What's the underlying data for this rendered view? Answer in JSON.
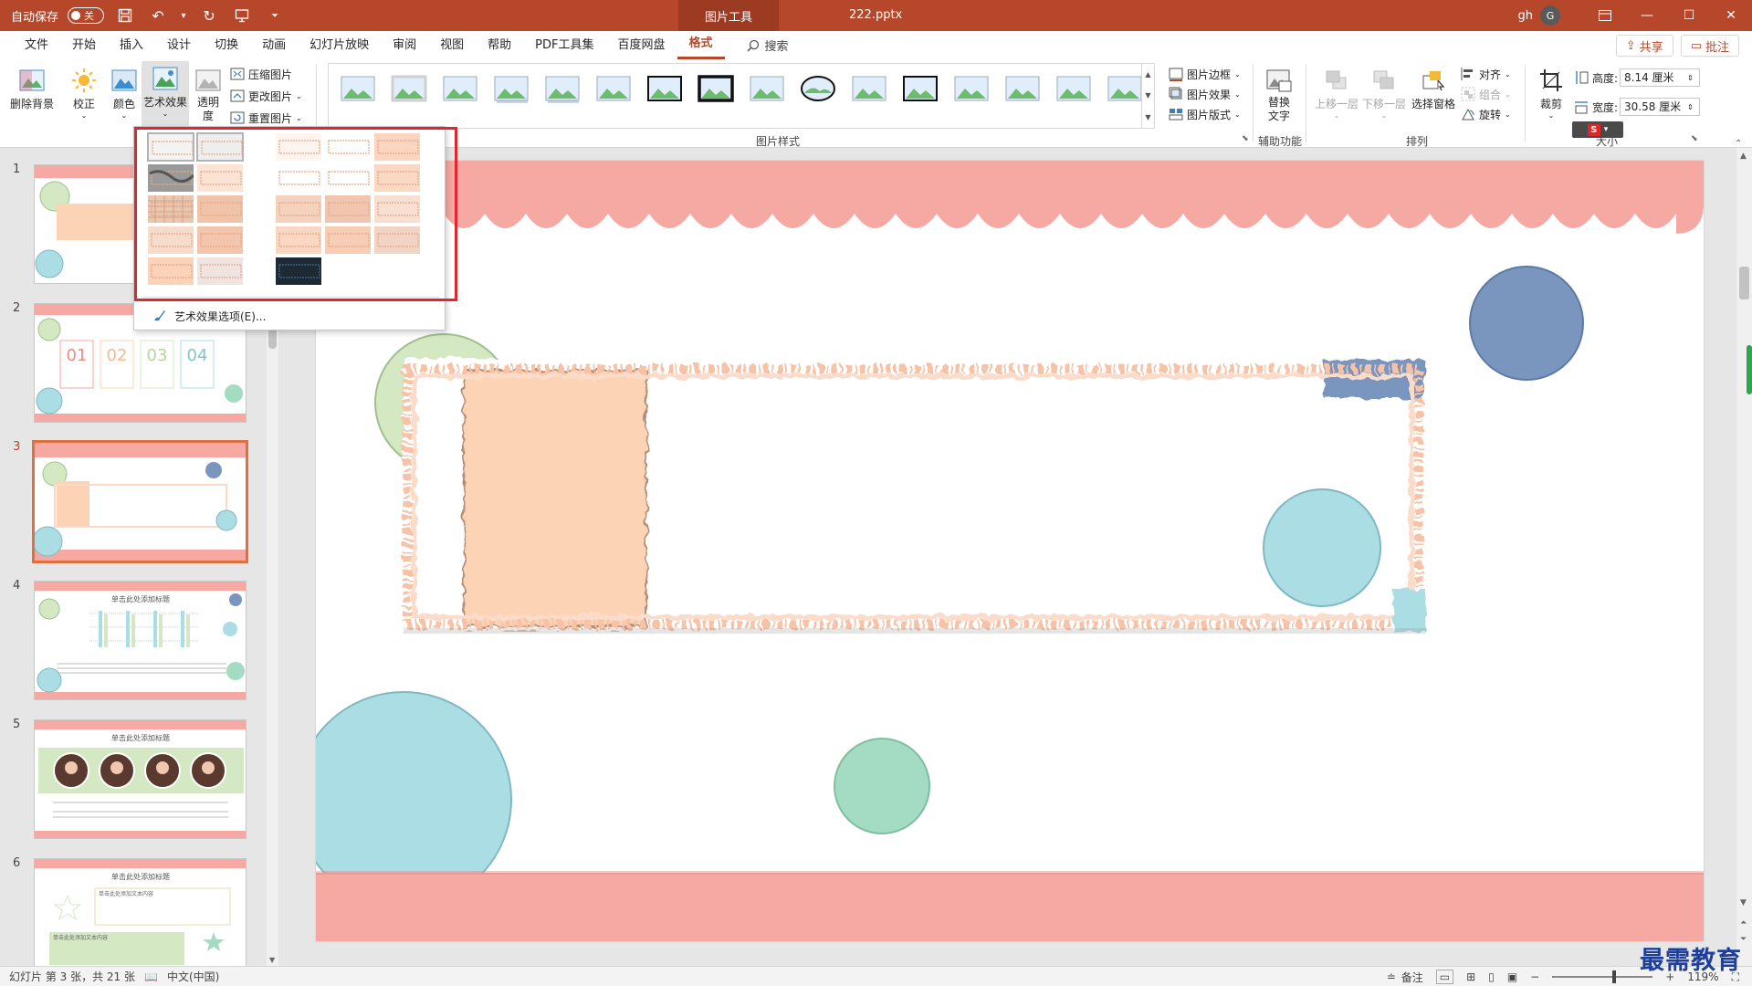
{
  "titlebar": {
    "autosave_label": "自动保存",
    "autosave_state": "关",
    "context_tab": "图片工具",
    "doc_title": "222.pptx",
    "user_name": "gh",
    "user_initial": "G"
  },
  "tabs": [
    {
      "label": "文件"
    },
    {
      "label": "开始"
    },
    {
      "label": "插入"
    },
    {
      "label": "设计"
    },
    {
      "label": "切换"
    },
    {
      "label": "动画"
    },
    {
      "label": "幻灯片放映"
    },
    {
      "label": "审阅"
    },
    {
      "label": "视图"
    },
    {
      "label": "帮助"
    },
    {
      "label": "PDF工具集"
    },
    {
      "label": "百度网盘"
    },
    {
      "label": "格式"
    }
  ],
  "search_label": "搜索",
  "share_label": "共享",
  "comment_label": "批注",
  "ribbon": {
    "remove_bg": "删除背景",
    "corrections": "校正",
    "color": "颜色",
    "artistic": "艺术效果",
    "transparency": "透明度",
    "compress": "压缩图片",
    "change_pic": "更改图片",
    "reset_pic": "重置图片",
    "styles_group": "图片样式",
    "pic_border": "图片边框",
    "pic_effects": "图片效果",
    "pic_layout": "图片版式",
    "alt_text": "替换文字",
    "accessibility_group": "辅助功能",
    "bring_forward": "上移一层",
    "send_backward": "下移一层",
    "selection_pane": "选择窗格",
    "align": "对齐",
    "group": "组合",
    "rotate": "旋转",
    "arrange_group": "排列",
    "crop": "裁剪",
    "height_label": "高度:",
    "height_value": "8.14 厘米",
    "width_label": "宽度:",
    "width_value": "30.58 厘米",
    "size_group": "大小"
  },
  "dropdown": {
    "option_label": "艺术效果选项(E)..."
  },
  "slides": [
    {
      "num": "1"
    },
    {
      "num": "2"
    },
    {
      "num": "3"
    },
    {
      "num": "4"
    },
    {
      "num": "5"
    },
    {
      "num": "6"
    }
  ],
  "slide2": {
    "n1": "01",
    "n2": "02",
    "n3": "03",
    "n4": "04"
  },
  "thumb_title": "单击此处添加标题",
  "thumb_text": "单击此处添加文本内容",
  "statusbar": {
    "slide_info": "幻灯片 第 3 张，共 21 张",
    "language": "中文(中国)",
    "notes": "备注",
    "zoom": "119%"
  },
  "watermark": "最需教育",
  "colors": {
    "accent": "#b7472a",
    "pink": "#f6a8a3",
    "peach": "#fdd3b6",
    "green": "#d5e8c4",
    "blue": "#aadde4",
    "navy": "#7a96bf",
    "mint": "#a4dcc3"
  }
}
